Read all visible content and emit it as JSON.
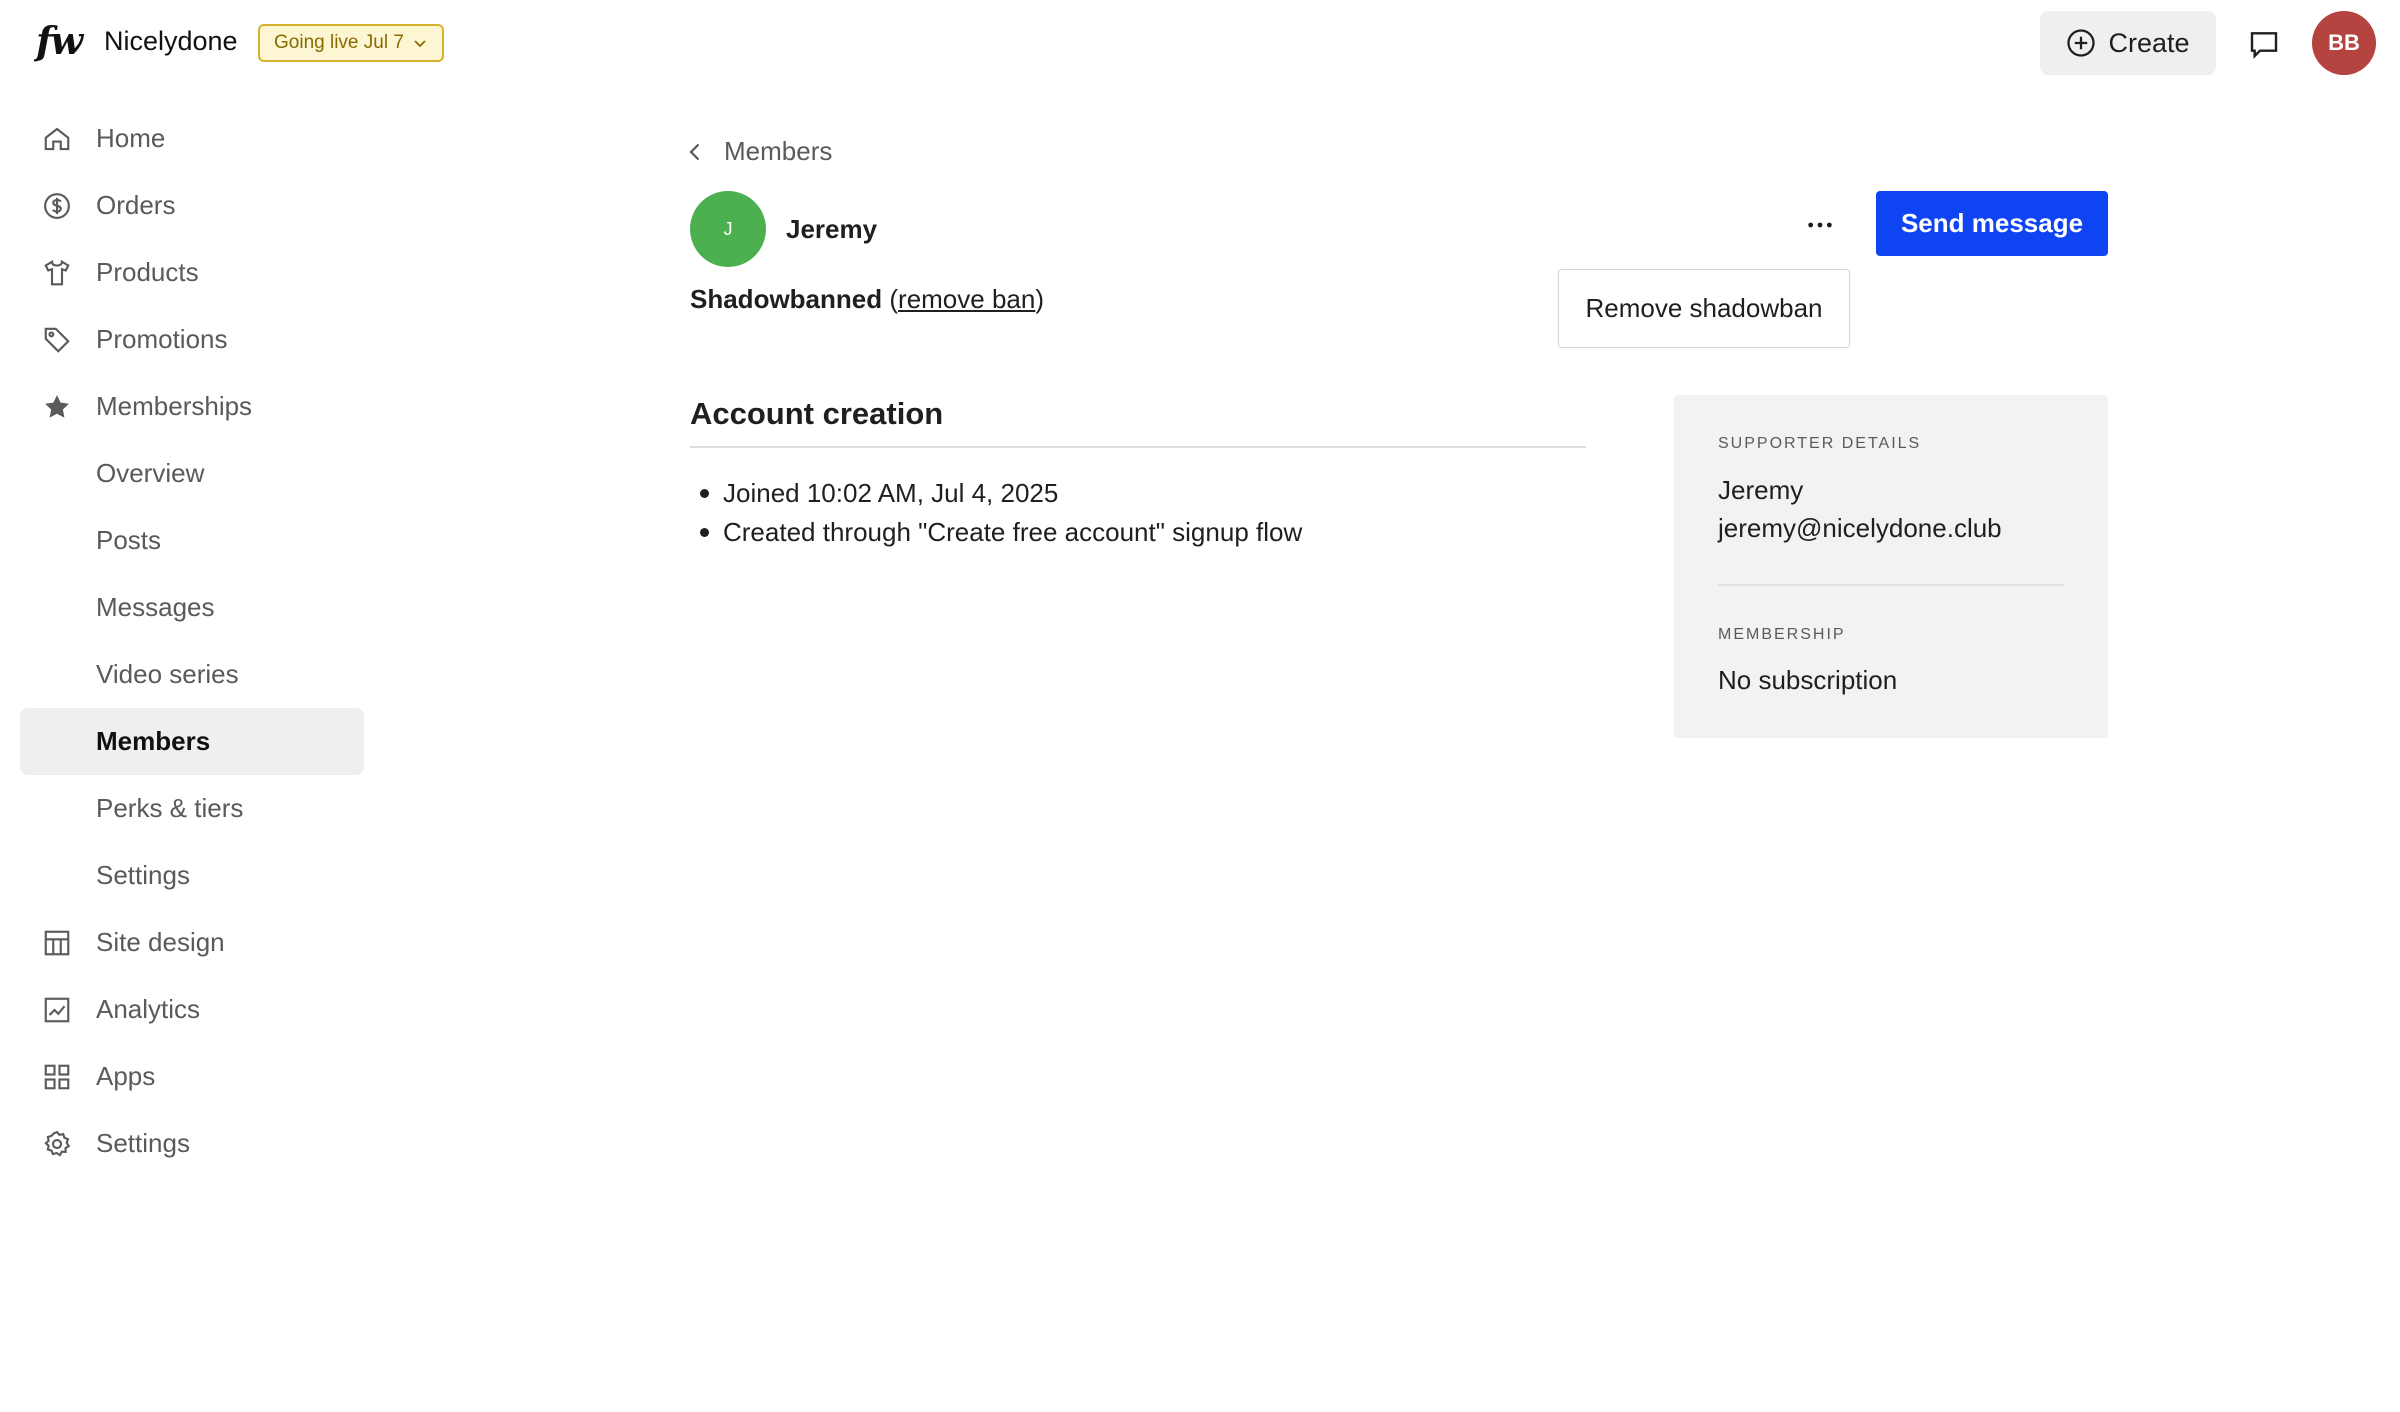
{
  "header": {
    "logo_text": "fw",
    "site_name": "Nicelydone",
    "status_pill": "Going live Jul 7",
    "create_label": "Create",
    "user_initials": "BB"
  },
  "sidebar": {
    "items": [
      {
        "label": "Home",
        "icon": "home-icon"
      },
      {
        "label": "Orders",
        "icon": "dollar-circle-icon"
      },
      {
        "label": "Products",
        "icon": "shirt-icon"
      },
      {
        "label": "Promotions",
        "icon": "tag-icon"
      },
      {
        "label": "Memberships",
        "icon": "star-icon"
      },
      {
        "label": "Overview"
      },
      {
        "label": "Posts"
      },
      {
        "label": "Messages"
      },
      {
        "label": "Video series"
      },
      {
        "label": "Members",
        "active": true
      },
      {
        "label": "Perks & tiers"
      },
      {
        "label": "Settings"
      },
      {
        "label": "Site design",
        "icon": "layout-icon"
      },
      {
        "label": "Analytics",
        "icon": "chart-icon"
      },
      {
        "label": "Apps",
        "icon": "grid-icon"
      },
      {
        "label": "Settings",
        "icon": "gear-icon"
      }
    ]
  },
  "main": {
    "back_label": "Members",
    "member": {
      "initial": "J",
      "name": "Jeremy",
      "ban_status": "Shadowbanned",
      "ban_link_open": "(",
      "ban_link": "remove ban",
      "ban_link_close": ")"
    },
    "send_message_label": "Send message",
    "dropdown": {
      "remove_shadowban_label": "Remove shadowban"
    },
    "account_creation": {
      "title": "Account creation",
      "facts": [
        "Joined 10:02 AM, Jul 4, 2025",
        "Created through \"Create free account\" signup flow"
      ]
    },
    "supporter_card": {
      "details_caption": "SUPPORTER DETAILS",
      "name": "Jeremy",
      "email": "jeremy@nicelydone.club",
      "membership_caption": "MEMBERSHIP",
      "membership_value": "No subscription"
    }
  },
  "colors": {
    "primary": "#0f44f2",
    "member_avatar": "#4caf50",
    "user_avatar": "#b5433f",
    "pill_border": "#d6b22b"
  }
}
